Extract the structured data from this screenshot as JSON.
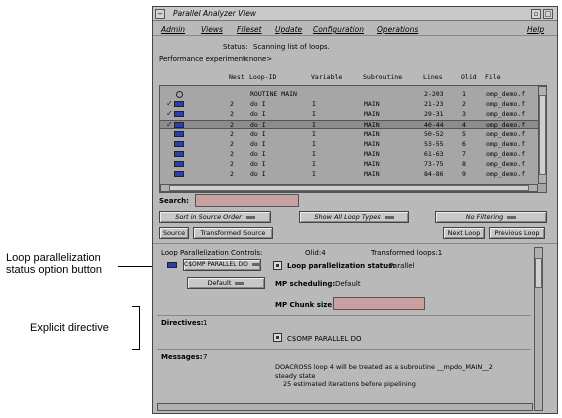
{
  "annotations": {
    "loop_button_line1": "Loop parallelization",
    "loop_button_line2": "status option button",
    "explicit_directive": "Explicit directive"
  },
  "window": {
    "title": "Parallel Analyzer View",
    "menu": [
      "Admin",
      "Views",
      "Fileset",
      "Update",
      "Configuration",
      "Operations",
      "Help"
    ]
  },
  "status": {
    "label": "Status:",
    "value": "Scanning list of loops.",
    "perf_label": "Performance experiment:",
    "perf_value": "<none>"
  },
  "list": {
    "headers": [
      "Nest",
      "Loop-ID",
      "Variable",
      "Subroutine",
      "Lines",
      "Olid",
      "File"
    ],
    "rows": [
      {
        "nest": "",
        "loop": "ROUTINE MAIN",
        "var": "",
        "sub": "",
        "lines": "2-203",
        "olid": "1",
        "file": "omp_demo.f",
        "icon": "circle",
        "check": false
      },
      {
        "nest": "2",
        "loop": "do I",
        "var": "I",
        "sub": "MAIN",
        "lines": "21-23",
        "olid": "2",
        "file": "omp_demo.f",
        "icon": "loop",
        "check": true
      },
      {
        "nest": "2",
        "loop": "do I",
        "var": "I",
        "sub": "MAIN",
        "lines": "29-31",
        "olid": "3",
        "file": "omp_demo.f",
        "icon": "loop",
        "check": true
      },
      {
        "nest": "2",
        "loop": "do I",
        "var": "I",
        "sub": "MAIN",
        "lines": "40-44",
        "olid": "4",
        "file": "omp_demo.f",
        "icon": "loop",
        "check": true
      },
      {
        "nest": "2",
        "loop": "do I",
        "var": "I",
        "sub": "MAIN",
        "lines": "50-52",
        "olid": "5",
        "file": "omp_demo.f",
        "icon": "loop",
        "check": false
      },
      {
        "nest": "2",
        "loop": "do I",
        "var": "I",
        "sub": "MAIN",
        "lines": "53-55",
        "olid": "6",
        "file": "omp_demo.f",
        "icon": "loop",
        "check": false
      },
      {
        "nest": "2",
        "loop": "do I",
        "var": "I",
        "sub": "MAIN",
        "lines": "61-63",
        "olid": "7",
        "file": "omp_demo.f",
        "icon": "loop",
        "check": false
      },
      {
        "nest": "2",
        "loop": "do I",
        "var": "I",
        "sub": "MAIN",
        "lines": "73-75",
        "olid": "8",
        "file": "omp_demo.f",
        "icon": "loop",
        "check": false
      },
      {
        "nest": "2",
        "loop": "do I",
        "var": "I",
        "sub": "MAIN",
        "lines": "84-86",
        "olid": "9",
        "file": "omp_demo.f",
        "icon": "loop",
        "check": false
      }
    ]
  },
  "search": {
    "label": "Search:",
    "value": ""
  },
  "filters": {
    "sort": "Sort in Source Order",
    "types": "Show All Loop Types",
    "filtering": "No Filtering"
  },
  "nav_buttons": {
    "source": "Source",
    "transformed": "Transformed Source",
    "next": "Next Loop",
    "previous": "Previous Loop"
  },
  "controls": {
    "title": "Loop Parallelization Controls:",
    "olid": "Olid:4",
    "transformed": "Transformed loops:1",
    "option_value": "C$OMP PARALLEL DO",
    "status_label": "Loop parallelization status:",
    "status_value": "Parallel",
    "sched_option": "Default",
    "sched_label": "MP scheduling:",
    "sched_value": "Default",
    "chunk_label": "MP Chunk size:",
    "chunk_value": ""
  },
  "directives": {
    "label": "Directives:",
    "count": "1",
    "item": "C$OMP PARALLEL DO"
  },
  "messages": {
    "label": "Messages:",
    "count": "7",
    "line1": "DOACROSS loop 4 will be treated as a subroutine __mpdo_MAIN__2",
    "line2": "steady state",
    "line3": "25 estimated iterations before pipelining"
  },
  "colors": {
    "window_bg": "#b9b9b9",
    "list_bg": "#a6a6a6",
    "field_bg": "#c9a0a0",
    "loop_icon": "#2a3fa8"
  }
}
